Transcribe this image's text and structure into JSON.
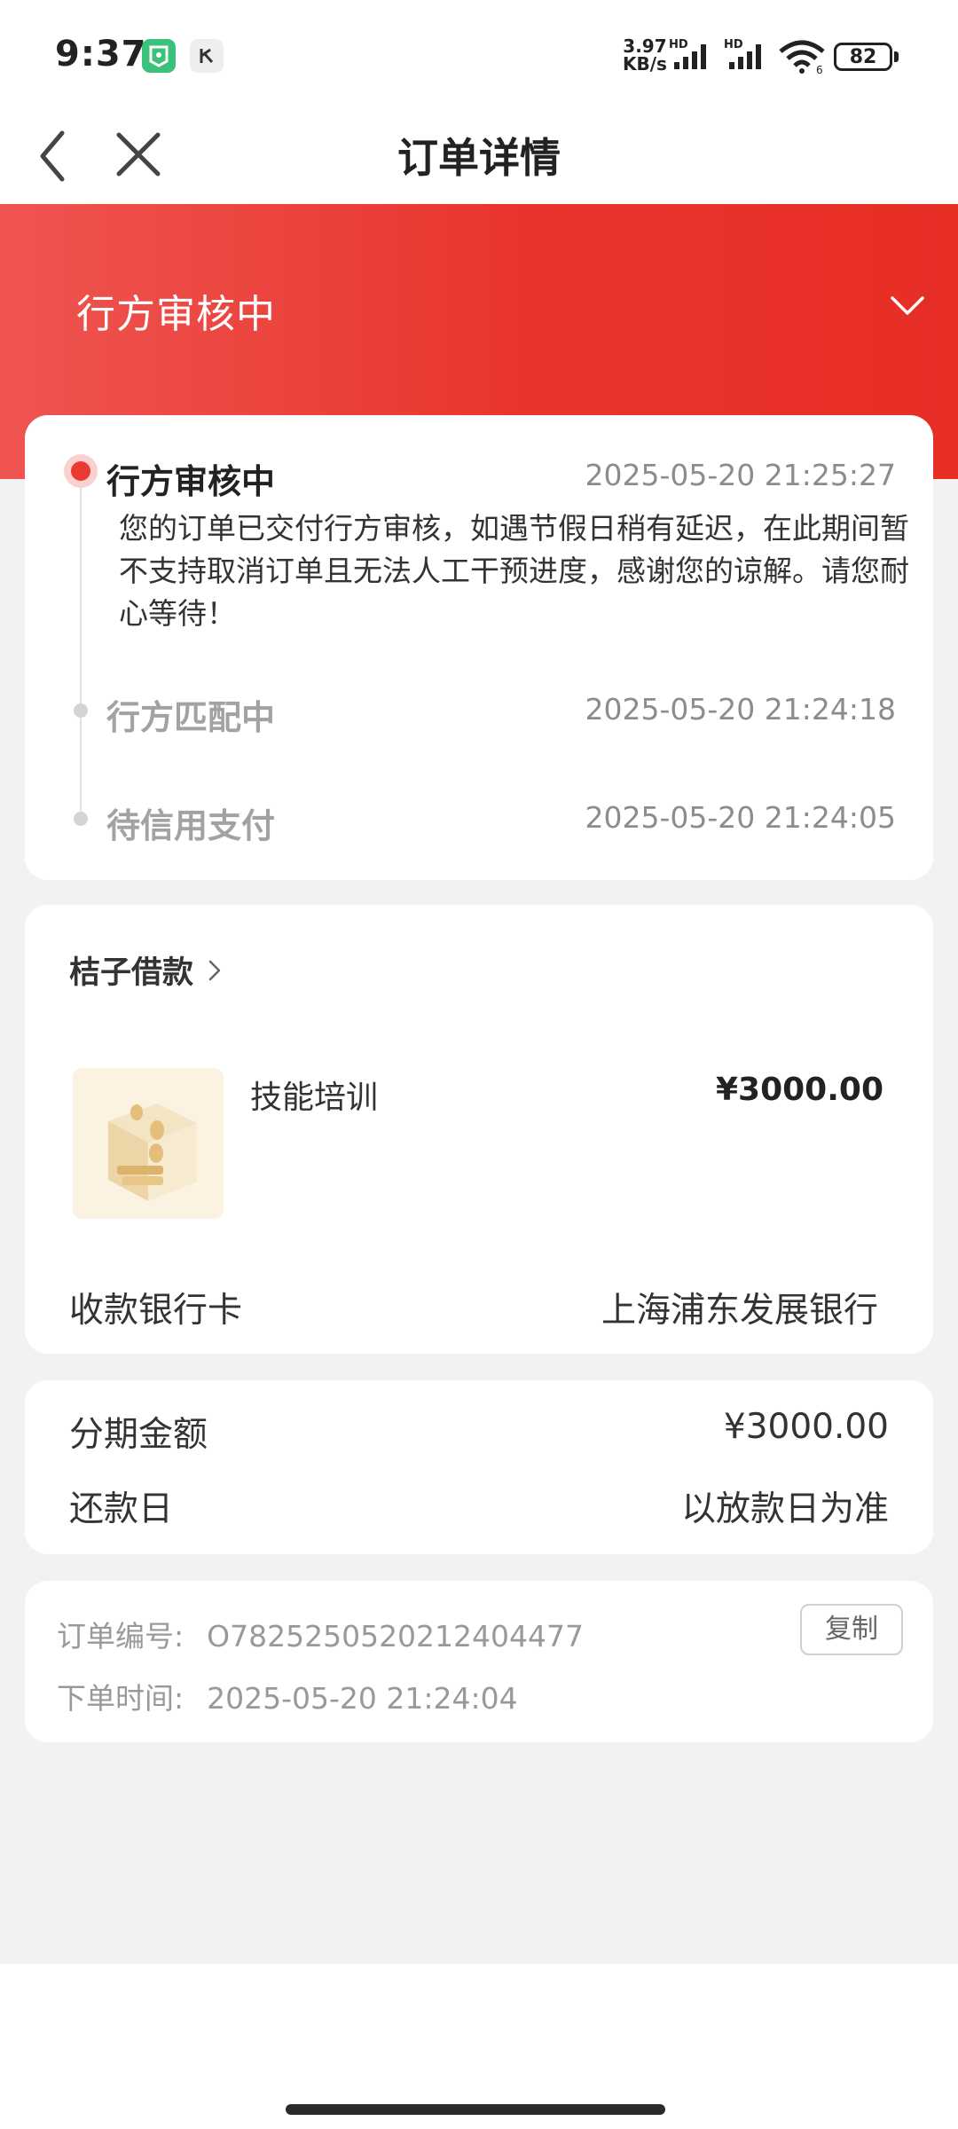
{
  "status_bar": {
    "time": "9:37",
    "speed_value": "3.97",
    "speed_unit": "KB/s",
    "hd1": "HD",
    "hd2": "HD",
    "wifi_label": "6",
    "battery": "82"
  },
  "nav": {
    "title": "订单详情",
    "back_icon": "chevron-left-icon",
    "close_icon": "close-icon"
  },
  "header": {
    "status": "行方审核中"
  },
  "timeline": [
    {
      "title": "行方审核中",
      "time": "2025-05-20 21:25:27",
      "desc": "您的订单已交付行方审核，如遇节假日稍有延迟，在此期间暂不支持取消订单且无法人工干预进度，感谢您的谅解。请您耐心等待！"
    },
    {
      "title": "行方匹配中",
      "time": "2025-05-20 21:24:18"
    },
    {
      "title": "待信用支付",
      "time": "2025-05-20 21:24:05"
    }
  ],
  "product": {
    "merchant": "桔子借款",
    "name": "技能培训",
    "price": "¥3000.00",
    "bank_label": "收款银行卡",
    "bank_value": "上海浦东发展银行"
  },
  "installment": {
    "amount_label": "分期金额",
    "amount_value": "¥3000.00",
    "repay_label": "还款日",
    "repay_value": "以放款日为准"
  },
  "order": {
    "number_label": "订单编号:",
    "number_value": "O7825250520212404477",
    "time_label": "下单时间:",
    "time_value": "2025-05-20 21:24:04",
    "copy_label": "复制"
  },
  "colors": {
    "accent": "#e9342d",
    "background": "#f2f2f2"
  }
}
